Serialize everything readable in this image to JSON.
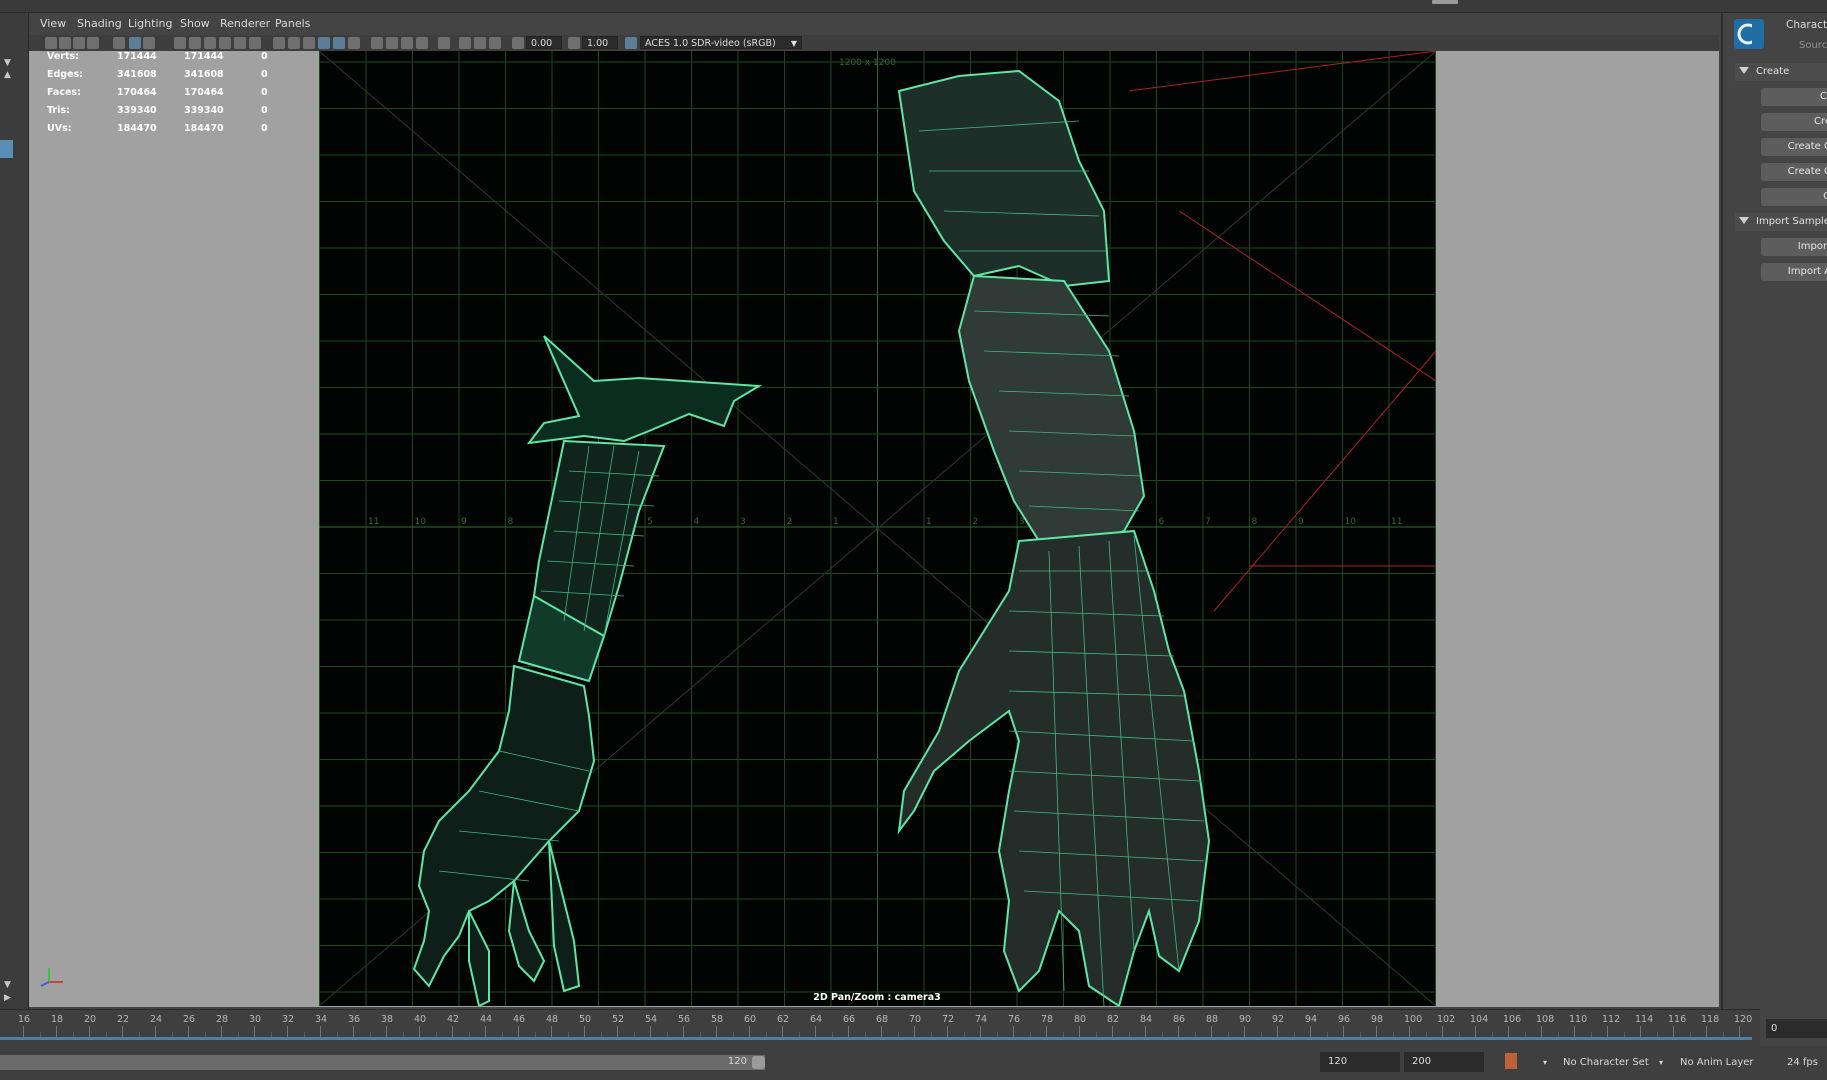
{
  "menu": {
    "items": [
      "View",
      "Shading",
      "Lighting",
      "Show",
      "Renderer",
      "Panels"
    ]
  },
  "toolbar": {
    "value_a": "0.00",
    "value_b": "1.00",
    "color_space": "ACES 1.0 SDR-video (sRGB)"
  },
  "hud": {
    "rows": [
      {
        "label": "Verts:",
        "a": "171444",
        "b": "171444",
        "c": "0"
      },
      {
        "label": "Edges:",
        "a": "341608",
        "b": "341608",
        "c": "0"
      },
      {
        "label": "Faces:",
        "a": "170464",
        "b": "170464",
        "c": "0"
      },
      {
        "label": "Tris:",
        "a": "339340",
        "b": "339340",
        "c": "0"
      },
      {
        "label": "UVs:",
        "a": "184470",
        "b": "184470",
        "c": "0"
      }
    ]
  },
  "viewport": {
    "camera_label": "2D Pan/Zoom : camera3",
    "resolution_label": "1200 x 1200",
    "grid_numbers": [
      "11",
      "10",
      "9",
      "8",
      "7",
      "6",
      "5",
      "4",
      "3",
      "2",
      "1"
    ],
    "wire_color": "#5ee6a5",
    "grid_color": "#1c4a1c"
  },
  "right_panel": {
    "title": "Characte",
    "subtitle": "Source",
    "section_create": "Create",
    "create_buttons": [
      "Cr",
      "Cre",
      "Create C",
      "Create C",
      "Q"
    ],
    "section_import": "Import Sample",
    "import_buttons": [
      "Import",
      "Import A"
    ]
  },
  "timeline": {
    "ticks": [
      "16",
      "18",
      "20",
      "22",
      "24",
      "26",
      "28",
      "30",
      "32",
      "34",
      "36",
      "38",
      "40",
      "42",
      "44",
      "46",
      "48",
      "50",
      "52",
      "54",
      "56",
      "58",
      "60",
      "62",
      "64",
      "66",
      "68",
      "70",
      "72",
      "74",
      "76",
      "78",
      "80",
      "82",
      "84",
      "86",
      "88",
      "90",
      "92",
      "94",
      "96",
      "98",
      "100",
      "102",
      "104",
      "106",
      "108",
      "110",
      "112",
      "114",
      "116",
      "118",
      "120"
    ],
    "current_frame": "0"
  },
  "range": {
    "slider_end": "120",
    "end_field": "120",
    "max_field": "200",
    "character_set": "No Character Set",
    "anim_layer": "No Anim Layer",
    "fps": "24 fps"
  },
  "colors": {
    "accent": "#4f7fa6",
    "selection": "#5a8fb5",
    "wire": "#5ee6a5"
  }
}
